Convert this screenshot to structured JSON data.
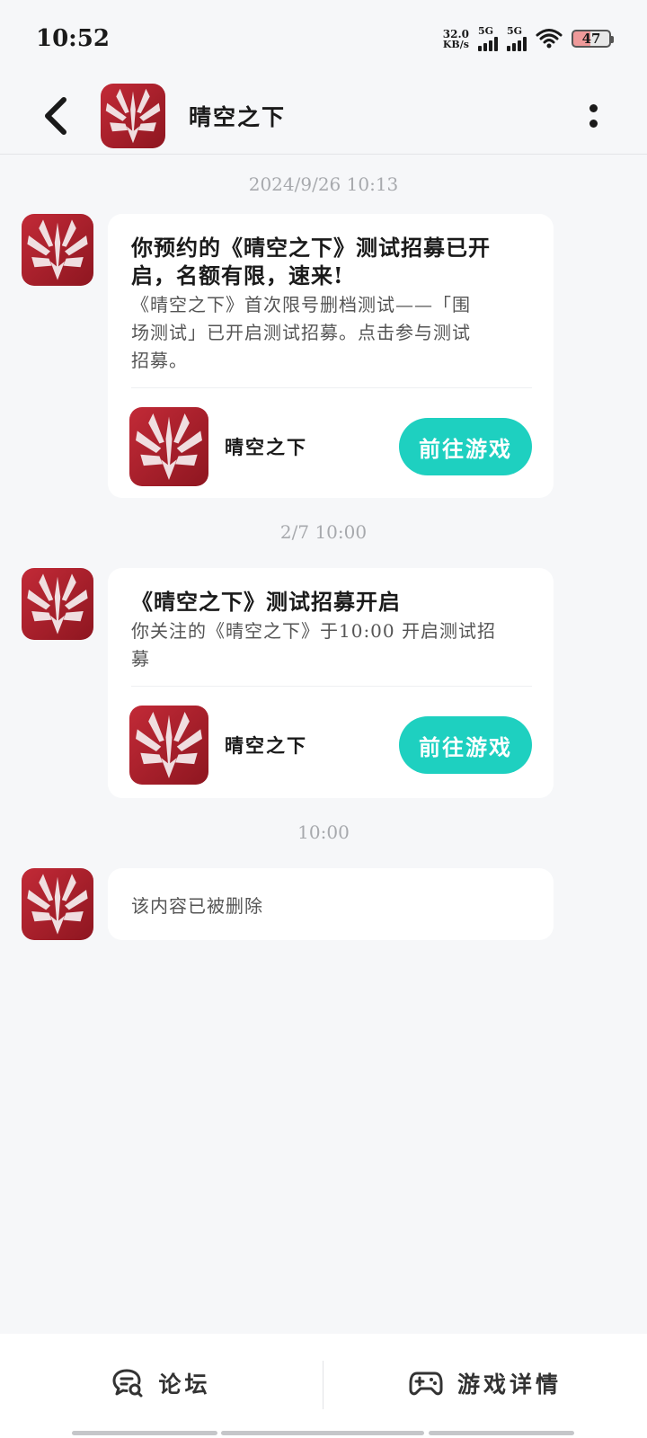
{
  "status_bar": {
    "time": "10:52",
    "net_speed_value": "32.0",
    "net_speed_unit": "KB/s",
    "sim1_label": "5G",
    "sim2_label": "5G",
    "battery": "47",
    "icons": [
      "signal-icon",
      "wifi-icon",
      "battery-icon"
    ]
  },
  "header": {
    "title": "晴空之下",
    "back_icon": "chevron-left-icon",
    "more_icon": "more-vertical-icon"
  },
  "messages": [
    {
      "timestamp": "2024/9/26 10:13",
      "title_line1": "你预约的《晴空之下》测试招募已开",
      "title_line2": "启，名额有限，速来!",
      "body_line1": "《晴空之下》首次限号删档测试——「围",
      "body_line2": "场测试」已开启测试招募。点击参与测试",
      "body_line3": "招募。",
      "game_name": "晴空之下",
      "button_label": "前往游戏"
    },
    {
      "timestamp": "2/7 10:00",
      "title_line1": "《晴空之下》测试招募开启",
      "body_line1": "你关注的《晴空之下》于10:00 开启测试招",
      "body_line2": "募",
      "game_name": "晴空之下",
      "button_label": "前往游戏"
    },
    {
      "timestamp": "10:00",
      "deleted_text": "该内容已被删除"
    }
  ],
  "bottom_tabs": [
    {
      "label": "论坛",
      "icon": "forum-chat-icon"
    },
    {
      "label": "游戏详情",
      "icon": "gamepad-icon"
    }
  ],
  "colors": {
    "accent": "#1ed0c0",
    "background": "#f6f7f9",
    "logo_red": "#b0222f"
  }
}
